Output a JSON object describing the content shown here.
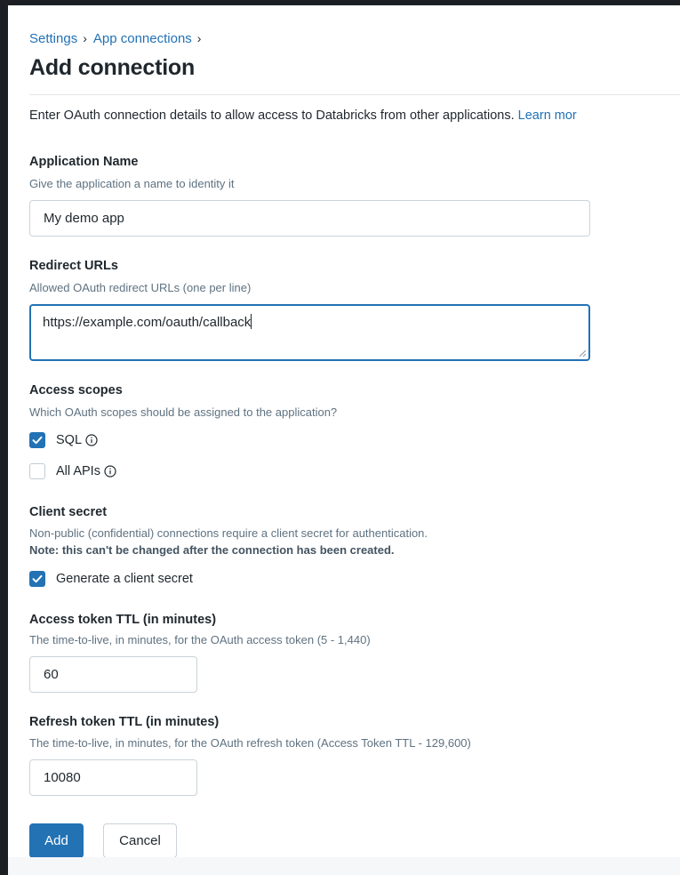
{
  "breadcrumb": {
    "items": [
      "Settings",
      "App connections"
    ],
    "separator": "›"
  },
  "page": {
    "title": "Add connection",
    "intro_text": "Enter OAuth connection details to allow access to Databricks from other applications. ",
    "learn_more": "Learn mor"
  },
  "app_name": {
    "label": "Application Name",
    "help": "Give the application a name to identity it",
    "value": "My demo app"
  },
  "redirect_urls": {
    "label": "Redirect URLs",
    "help": "Allowed OAuth redirect URLs (one per line)",
    "value": "https://example.com/oauth/callback"
  },
  "access_scopes": {
    "label": "Access scopes",
    "help": "Which OAuth scopes should be assigned to the application?",
    "options": [
      {
        "label": "SQL",
        "checked": true,
        "icon": "info-icon"
      },
      {
        "label": "All APIs",
        "checked": false,
        "icon": "info-icon"
      }
    ]
  },
  "client_secret": {
    "label": "Client secret",
    "help": "Non-public (confidential) connections require a client secret for authentication.",
    "note": "Note: this can't be changed after the connection has been created.",
    "option_label": "Generate a client secret",
    "checked": true
  },
  "access_ttl": {
    "label": "Access token TTL (in minutes)",
    "help": "The time-to-live, in minutes, for the OAuth access token (5 - 1,440)",
    "value": "60"
  },
  "refresh_ttl": {
    "label": "Refresh token TTL (in minutes)",
    "help": "The time-to-live, in minutes, for the OAuth refresh token (Access Token TTL - 129,600)",
    "value": "10080"
  },
  "actions": {
    "add_label": "Add",
    "cancel_label": "Cancel"
  },
  "colors": {
    "accent": "#2272b4",
    "text": "#1f272d",
    "muted": "#5f7281",
    "border": "#cbd2d8"
  }
}
